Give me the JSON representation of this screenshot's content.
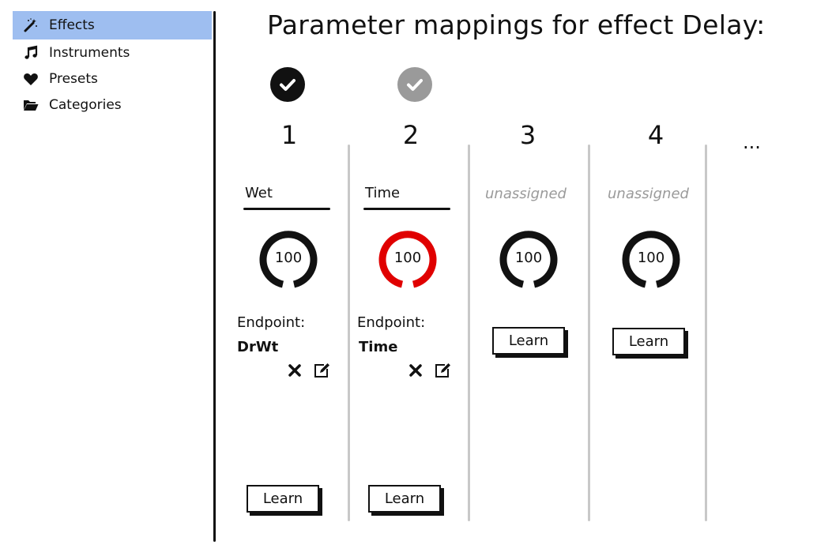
{
  "sidebar": {
    "items": [
      {
        "label": "Effects",
        "icon": "magic-wand-icon",
        "active": true
      },
      {
        "label": "Instruments",
        "icon": "music-note-icon",
        "active": false
      },
      {
        "label": "Presets",
        "icon": "heart-icon",
        "active": false
      },
      {
        "label": "Categories",
        "icon": "folder-open-icon",
        "active": false
      }
    ],
    "active_color": "#9ebef0"
  },
  "title": "Parameter mappings for effect Delay:",
  "status": [
    {
      "icon": "check-circle-icon",
      "color": "#111111"
    },
    {
      "icon": "check-circle-icon",
      "color": "#9a9a9a"
    }
  ],
  "columns": [
    {
      "number": "1",
      "param": "Wet",
      "knob_value": "100",
      "knob_color": "#111111",
      "endpoint_label": "Endpoint:",
      "endpoint_value": "DrWt",
      "learn_label": "Learn"
    },
    {
      "number": "2",
      "param": "Time",
      "knob_value": "100",
      "knob_color": "#e00000",
      "endpoint_label": "Endpoint:",
      "endpoint_value": "Time",
      "learn_label": "Learn"
    },
    {
      "number": "3",
      "param": "unassigned",
      "knob_value": "100",
      "knob_color": "#111111",
      "learn_label": "Learn"
    },
    {
      "number": "4",
      "param": "unassigned",
      "knob_value": "100",
      "knob_color": "#111111",
      "learn_label": "Learn"
    }
  ],
  "more": "..."
}
